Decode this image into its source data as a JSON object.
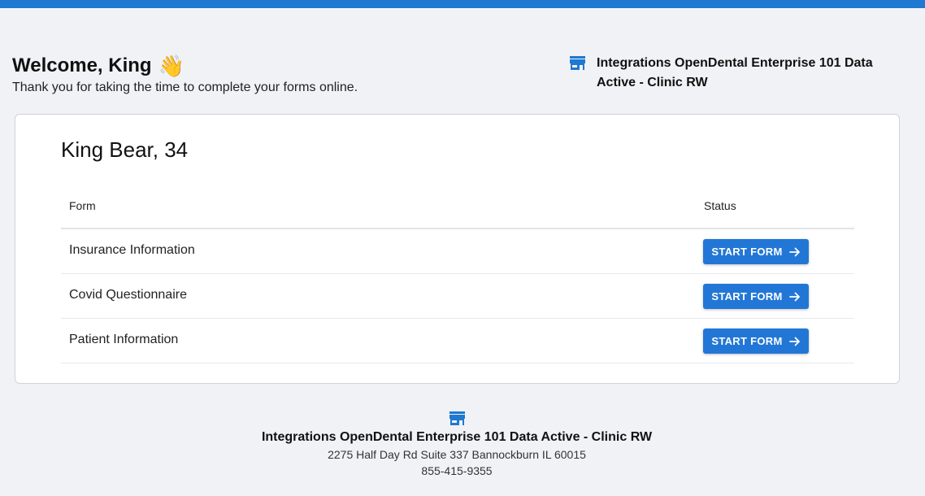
{
  "header": {
    "welcome": "Welcome, King",
    "wave_emoji": "👋",
    "subtitle": "Thank you for taking the time to complete your forms online.",
    "clinic_name": "Integrations OpenDental Enterprise 101 Data Active - Clinic RW"
  },
  "card": {
    "patient": "King Bear, 34",
    "columns": {
      "form": "Form",
      "status": "Status"
    },
    "rows": [
      {
        "form": "Insurance Information",
        "action": "START FORM"
      },
      {
        "form": "Covid Questionnaire",
        "action": "START FORM"
      },
      {
        "form": "Patient Information",
        "action": "START FORM"
      }
    ]
  },
  "footer": {
    "clinic_name": "Integrations OpenDental Enterprise 101 Data Active - Clinic RW",
    "address": "2275 Half Day Rd Suite 337 Bannockburn IL 60015",
    "phone": "855-415-9355"
  },
  "icons": {
    "store": "store-icon",
    "arrow": "arrow-right-icon",
    "wave": "waving-hand-icon"
  },
  "colors": {
    "accent": "#1f78d1",
    "button": "#2277d6",
    "background": "#f0f2f5"
  }
}
